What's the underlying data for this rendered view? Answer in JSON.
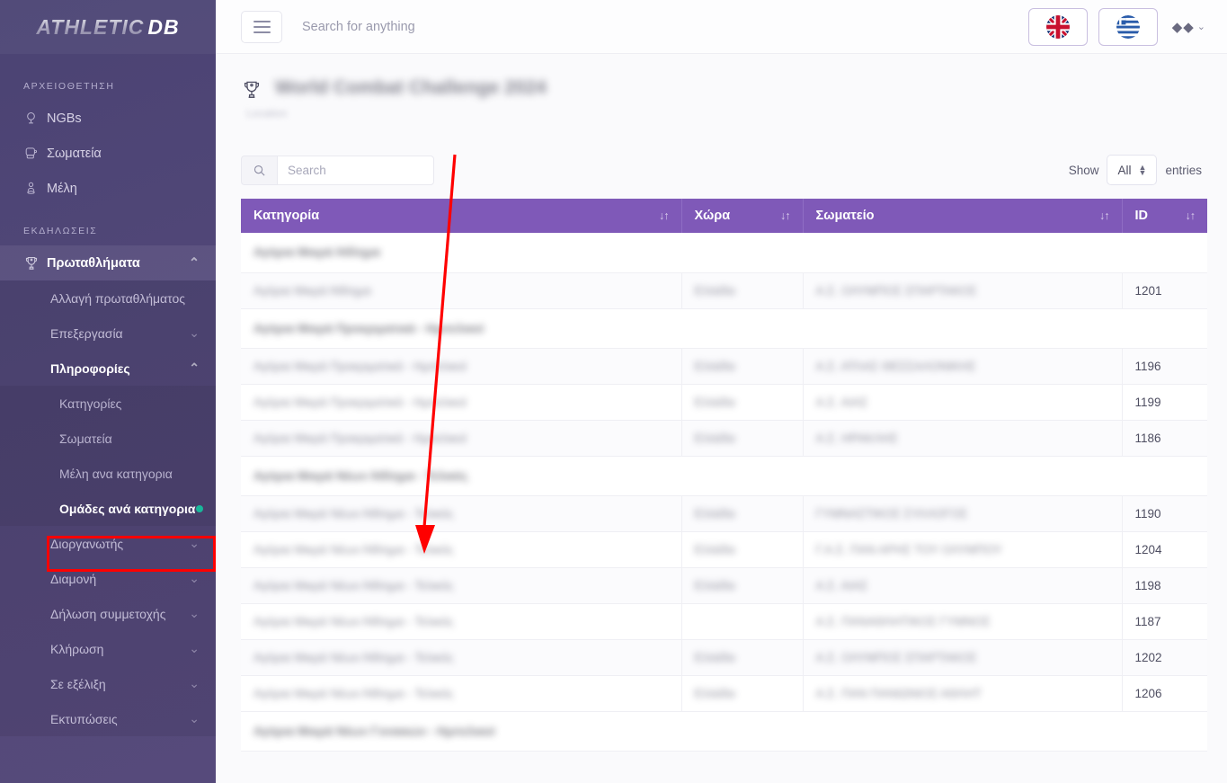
{
  "brand": {
    "part1": "ATHLETIC",
    "part2": "DB"
  },
  "topbar": {
    "search_placeholder": "Search for anything",
    "menu_toggle": "☰",
    "lang_en": "en",
    "lang_gr": "gr",
    "user_glyphs": "◆◆",
    "user_chevron": "⌄"
  },
  "sidebar": {
    "sections": [
      {
        "label": "ΑΡΧΕΙΟΘΕΤΗΣΗ"
      },
      {
        "label": "ΕΚΔΗΛΩΣΕΙΣ"
      }
    ],
    "archive_items": [
      {
        "label": "NGBs",
        "icon": "globe-lamp-icon"
      },
      {
        "label": "Σωματεία",
        "icon": "boxing-glove-icon"
      },
      {
        "label": "Μέλη",
        "icon": "person-icon"
      }
    ],
    "events_parent": {
      "label": "Πρωταθλήματα",
      "icon": "trophy-icon",
      "chevron": "⌃"
    },
    "events_children": [
      {
        "label": "Αλλαγή πρωταθλήματος",
        "chevron": ""
      },
      {
        "label": "Επεξεργασία",
        "chevron": "⌄"
      },
      {
        "label": "Πληροφορίες",
        "chevron": "⌃",
        "open": true
      }
    ],
    "info_children": [
      {
        "label": "Κατηγορίες",
        "current": false
      },
      {
        "label": "Σωματεία",
        "current": false
      },
      {
        "label": "Μέλη ανα κατηγορια",
        "current": false
      },
      {
        "label": "Ομάδες ανά κατηγορια",
        "current": true
      }
    ],
    "tail_items": [
      {
        "label": "Διοργανωτής",
        "chevron": "⌄"
      },
      {
        "label": "Διαμονή",
        "chevron": "⌄"
      },
      {
        "label": "Δήλωση συμμετοχής",
        "chevron": "⌄"
      },
      {
        "label": "Κλήρωση",
        "chevron": "⌄"
      },
      {
        "label": "Σε εξέλιξη",
        "chevron": "⌄"
      },
      {
        "label": "Εκτυπώσεις",
        "chevron": "⌄"
      }
    ]
  },
  "page": {
    "title": "World Combat Challenge 2024",
    "subtitle": "Location"
  },
  "controls": {
    "search_placeholder": "Search",
    "show_label": "Show",
    "entries_value": "All",
    "entries_label": "entries"
  },
  "table": {
    "columns": [
      {
        "label": "Κατηγορία",
        "sort": "↓↑"
      },
      {
        "label": "Χώρα",
        "sort": "↓↑"
      },
      {
        "label": "Σωματείο",
        "sort": "↓↑"
      },
      {
        "label": "ID",
        "sort": "↓↑"
      }
    ],
    "rows": [
      {
        "type": "group",
        "category": "Αγόρια Μικρά Άθλημα"
      },
      {
        "type": "data",
        "category": "Αγόρια Μικρά Άθλημα",
        "country": "Ελλάδα",
        "club": "Α.Σ. ΟΛΥΜΠΟΣ ΣΠΑΡΤΑΚΟΣ",
        "id": "1201"
      },
      {
        "type": "group",
        "category": "Αγόρια Μικρά Προκριματικά - Ημιτελικοί"
      },
      {
        "type": "data",
        "category": "Αγόρια Μικρά Προκριματικά - Ημιτελικοί",
        "country": "Ελλάδα",
        "club": "Α.Σ. ΑΤΛΑΣ ΘΕΣΣΑΛΟΝΙΚΗΣ",
        "id": "1196"
      },
      {
        "type": "data",
        "category": "Αγόρια Μικρά Προκριματικά - Ημιτελικοί",
        "country": "Ελλάδα",
        "club": "Α.Σ. ΑΙΑΣ",
        "id": "1199"
      },
      {
        "type": "data",
        "category": "Αγόρια Μικρά Προκριματικά - Ημιτελικοί",
        "country": "Ελλάδα",
        "club": "Α.Σ. ΗΡΑΚΛΗΣ",
        "id": "1186"
      },
      {
        "type": "group",
        "category": "Αγόρια Μικρά Νέων Άθλημα - Τελικός"
      },
      {
        "type": "data",
        "category": "Αγόρια Μικρά Νέων Άθλημα - Τελικός",
        "country": "Ελλάδα",
        "club": "ΓΥΜΝΑΣΤΙΚΟΣ ΣΥΛΛΟΓΟΣ",
        "id": "1190"
      },
      {
        "type": "data",
        "category": "Αγόρια Μικρά Νέων Άθλημα - Τελικός",
        "country": "Ελλάδα",
        "club": "Γ.Α.Σ. ΠΑΝ ΑΡΗΣ ΤΟΥ ΟΛΥΜΠΟΥ",
        "id": "1204"
      },
      {
        "type": "data",
        "category": "Αγόρια Μικρά Νέων Άθλημα - Τελικός",
        "country": "Ελλάδα",
        "club": "Α.Σ. ΑΙΑΣ",
        "id": "1198"
      },
      {
        "type": "data",
        "category": "Αγόρια Μικρά Νέων Άθλημα - Τελικός",
        "country": "",
        "club": "Α.Σ. ΠΑΝΑΘΛΗΤΙΚΟΣ ΓΥΜΝΟΣ",
        "id": "1187"
      },
      {
        "type": "data",
        "category": "Αγόρια Μικρά Νέων Άθλημα - Τελικός",
        "country": "Ελλάδα",
        "club": "Α.Σ. ΟΛΥΜΠΟΣ ΣΠΑΡΤΑΚΟΣ",
        "id": "1202"
      },
      {
        "type": "data",
        "category": "Αγόρια Μικρά Νέων Άθλημα - Τελικός",
        "country": "Ελλάδα",
        "club": "Α.Σ. ΠΑΝ ΠΑΝΙΩΝΙΟΣ ΑΘΛΗΤ",
        "id": "1206"
      },
      {
        "type": "group",
        "category": "Αγόρια Μικρά Νέων Γυναικών - Ημιτελικοί"
      }
    ]
  },
  "annotation": {
    "color": "#ff0000",
    "target": "Ομάδες ανά κατηγορια"
  }
}
